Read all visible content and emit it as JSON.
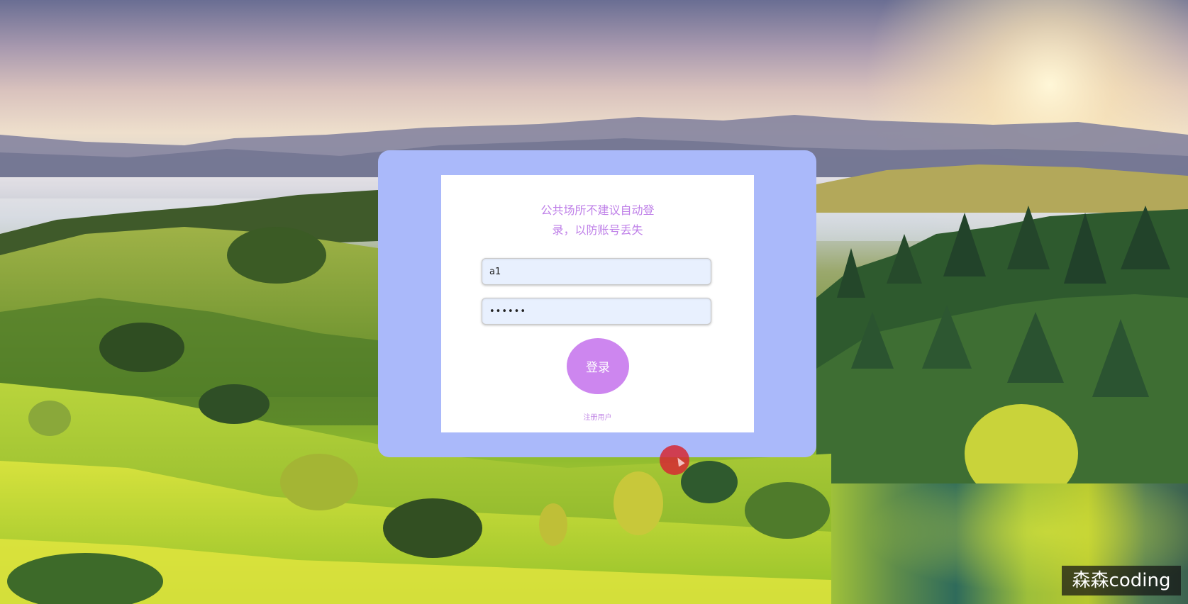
{
  "login": {
    "notice_line1": "公共场所不建议自动登",
    "notice_line2": "录，以防账号丢失",
    "username_value": "a1",
    "password_value": "••••••",
    "login_button": "登录",
    "register_link": "注册用户"
  },
  "watermark": {
    "text": "森森coding"
  },
  "colors": {
    "panel": "#aab9fa",
    "accent": "#cd86ef",
    "notice_text": "#bf80e8",
    "input_bg": "#e8f0fe"
  }
}
